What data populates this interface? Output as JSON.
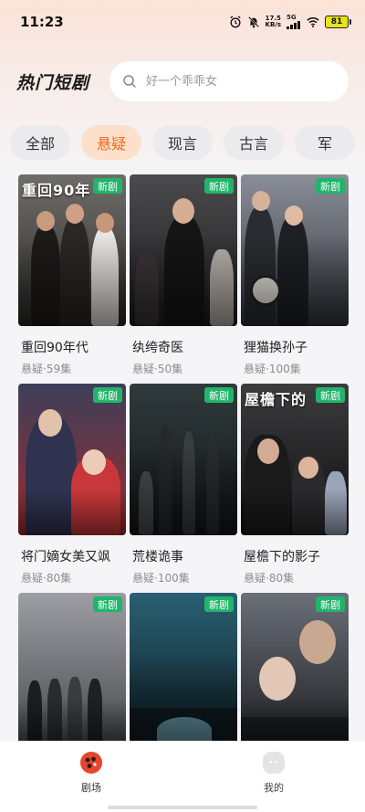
{
  "status_bar": {
    "time": "11:23",
    "net_speed_value": "17.5",
    "net_speed_unit": "KB/s",
    "network": "5G",
    "battery": "81"
  },
  "header": {
    "title": "热门短剧",
    "search_placeholder": "好一个乖乖女"
  },
  "tabs": [
    {
      "label": "全部",
      "active": false
    },
    {
      "label": "悬疑",
      "active": true
    },
    {
      "label": "现言",
      "active": false
    },
    {
      "label": "古言",
      "active": false
    },
    {
      "label": "军",
      "active": false
    }
  ],
  "dramas": [
    {
      "title": "重回90年代",
      "meta": "悬疑·59集",
      "badge": "新剧",
      "cover_text": "重回90年",
      "colors": [
        "#6f6d6a",
        "#2d2a27"
      ]
    },
    {
      "title": "纨绔奇医",
      "meta": "悬疑·50集",
      "badge": "新剧",
      "cover_text": "",
      "colors": [
        "#4b4a4c",
        "#1c1b1d"
      ]
    },
    {
      "title": "狸猫换孙子",
      "meta": "悬疑·100集",
      "badge": "新剧",
      "cover_text": "",
      "colors": [
        "#8a8e98",
        "#33363d"
      ]
    },
    {
      "title": "将门嫡女美又飒",
      "meta": "悬疑·80集",
      "badge": "新剧",
      "cover_text": "",
      "colors": [
        "#3c3f5a",
        "#9d2b2e"
      ]
    },
    {
      "title": "荒楼诡事",
      "meta": "悬疑·100集",
      "badge": "新剧",
      "cover_text": "",
      "colors": [
        "#2f3a3c",
        "#121617"
      ]
    },
    {
      "title": "屋檐下的影子",
      "meta": "悬疑·80集",
      "badge": "新剧",
      "cover_text": "屋檐下的",
      "colors": [
        "#3d3d3f",
        "#0d0d0e"
      ]
    },
    {
      "title": "",
      "meta": "",
      "badge": "新剧",
      "cover_text": "",
      "colors": [
        "#9c9ea3",
        "#4a4b50"
      ]
    },
    {
      "title": "",
      "meta": "",
      "badge": "新剧",
      "cover_text": "",
      "colors": [
        "#2a5f73",
        "#0e2026"
      ]
    },
    {
      "title": "",
      "meta": "",
      "badge": "新剧",
      "cover_text": "",
      "colors": [
        "#6a6f78",
        "#1f2024"
      ]
    }
  ],
  "tabbar": {
    "theater_label": "剧场",
    "mine_label": "我的",
    "accent": "#e4462d"
  }
}
